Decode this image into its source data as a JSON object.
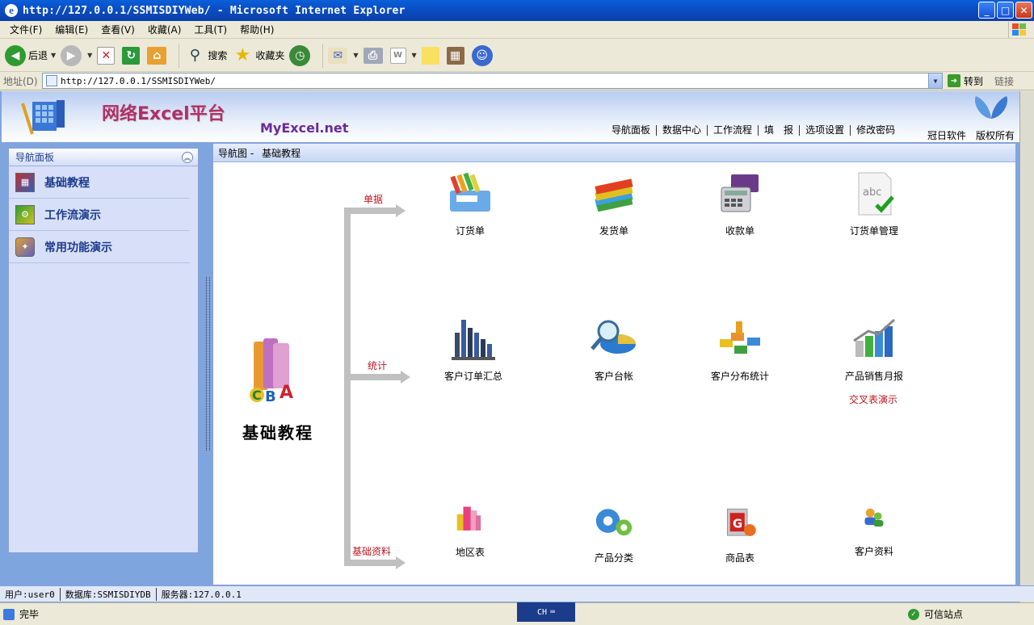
{
  "window": {
    "title": "http://127.0.0.1/SSMISDIYWeb/ - Microsoft Internet Explorer"
  },
  "menu": [
    "文件(F)",
    "编辑(E)",
    "查看(V)",
    "收藏(A)",
    "工具(T)",
    "帮助(H)"
  ],
  "toolbar": {
    "back": "后退",
    "search": "搜索",
    "favorites": "收藏夹"
  },
  "address": {
    "label": "地址(D)",
    "url": "http://127.0.0.1/SSMISDIYWeb/",
    "go": "转到",
    "links": "链接"
  },
  "header": {
    "brand": "网络Excel平台",
    "site": "MyExcel.net",
    "nav": [
      "导航面板",
      "数据中心",
      "工作流程",
      "填　报",
      "选项设置",
      "修改密码"
    ],
    "company": "冠日软件",
    "rights": "版权所有"
  },
  "sidebar": {
    "title": "导航面板",
    "items": [
      {
        "label": "基础教程",
        "icon": "grid-icon"
      },
      {
        "label": "工作流演示",
        "icon": "gear-book-icon"
      },
      {
        "label": "常用功能演示",
        "icon": "toolbox-icon"
      }
    ]
  },
  "main": {
    "crumb_prefix": "导航图 -",
    "crumb_current": "基础教程",
    "hero": "基础教程",
    "categories": [
      "单据",
      "统计",
      "基础资料"
    ],
    "nodes": [
      {
        "label": "订货单",
        "icon": "save-tray-icon"
      },
      {
        "label": "发货单",
        "icon": "books-icon"
      },
      {
        "label": "收款单",
        "icon": "card-terminal-icon"
      },
      {
        "label": "订货单管理",
        "icon": "abc-check-icon"
      },
      {
        "label": "客户订单汇总",
        "icon": "bar-chart-icon"
      },
      {
        "label": "客户台帐",
        "icon": "magnifier-pie-icon"
      },
      {
        "label": "客户分布统计",
        "icon": "distribution-icon"
      },
      {
        "label": "产品销售月报",
        "icon": "growth-chart-icon"
      },
      {
        "label": "地区表",
        "icon": "buildings-icon"
      },
      {
        "label": "产品分类",
        "icon": "gears-icon"
      },
      {
        "label": "商品表",
        "icon": "product-box-icon"
      },
      {
        "label": "客户资料",
        "icon": "users-icon"
      }
    ],
    "cross_table": "交叉表演示"
  },
  "status": {
    "user": "用户:user0",
    "db": "数据库:SSMISDIYDB",
    "server": "服务器:127.0.0.1"
  },
  "iestatus": {
    "done": "完毕",
    "ime": "CH",
    "zone": "可信站点"
  }
}
